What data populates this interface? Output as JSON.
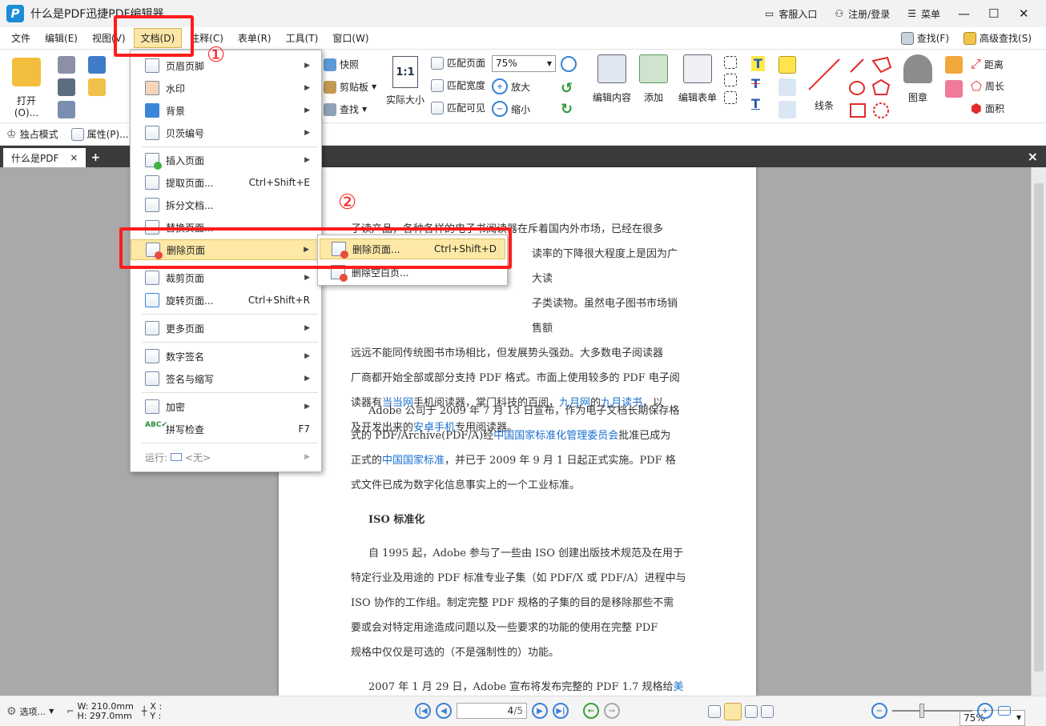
{
  "app": {
    "title": "什么是PDF迅捷PDF编辑器",
    "logo_icon": "pdf-editor-logo-icon"
  },
  "titlebar": {
    "support": "客服入口",
    "login": "注册/登录",
    "menu": "菜单"
  },
  "menubar": {
    "items": [
      "文件",
      "编辑(E)",
      "视图(V)",
      "文档(D)",
      "注释(C)",
      "表单(R)",
      "工具(T)",
      "窗口(W)"
    ],
    "find": "查找(F)",
    "advanced_find": "高级查找(S)"
  },
  "ribbon": {
    "open": "打开(O)...",
    "snapshot": "快照",
    "clipboard": "剪贴板",
    "find": "查找",
    "actual_size": "实际大小",
    "fit_page": "匹配页面",
    "fit_width": "匹配宽度",
    "fit_visible": "匹配可见",
    "zoom_value": "75%",
    "zoom_in": "放大",
    "zoom_out": "缩小",
    "edit_content": "编辑内容",
    "add": "添加",
    "edit_form": "编辑表单",
    "lines": "线条",
    "stamp": "图章",
    "distance": "距离",
    "perimeter": "周长",
    "area": "面积",
    "exclusive_mode": "独占模式",
    "properties": "属性(P)..."
  },
  "tabs": {
    "doc_tab": "什么是PDF",
    "add": "+",
    "close": "×"
  },
  "doc_menu": {
    "items": [
      {
        "label": "页眉页脚",
        "shortcut": ""
      },
      {
        "label": "水印",
        "shortcut": ""
      },
      {
        "label": "背景",
        "shortcut": ""
      },
      {
        "label": "贝茨编号",
        "shortcut": ""
      },
      {
        "label": "插入页面",
        "shortcut": ""
      },
      {
        "label": "提取页面...",
        "shortcut": "Ctrl+Shift+E"
      },
      {
        "label": "拆分文档...",
        "shortcut": ""
      },
      {
        "label": "替换页面...",
        "shortcut": ""
      },
      {
        "label": "删除页面",
        "shortcut": ""
      },
      {
        "label": "裁剪页面",
        "shortcut": ""
      },
      {
        "label": "旋转页面...",
        "shortcut": "Ctrl+Shift+R"
      },
      {
        "label": "更多页面",
        "shortcut": ""
      },
      {
        "label": "数字签名",
        "shortcut": ""
      },
      {
        "label": "签名与缩写",
        "shortcut": ""
      },
      {
        "label": "加密",
        "shortcut": ""
      },
      {
        "label": "拼写检查",
        "shortcut": "F7"
      }
    ],
    "run_label": "运行:",
    "run_value": "<无>"
  },
  "sub_menu": {
    "items": [
      {
        "label": "删除页面...",
        "shortcut": "Ctrl+Shift+D"
      },
      {
        "label": "删除空白页...",
        "shortcut": ""
      }
    ]
  },
  "annotations": {
    "step1": "①",
    "step2": "②",
    "color": "#ff1c1c"
  },
  "document": {
    "p1": [
      "子读产品，各种各样的电子书阅读器在斥着国内外市场，已经在很多",
      "读率的下降很大程度上是因为广大读",
      "子类读物。虽然电子图书市场销售额",
      "远远不能同传统图书市场相比，但发展势头强劲。大多数电子阅读器",
      "厂商都开始全部或部分支持 PDF 格式。市面上使用较多的 PDF 电子阅"
    ],
    "p1_last_a": "读器有",
    "p1_link1": "当当网",
    "p1_last_b": "手机阅读器，掌门科技的百阅，",
    "p1_link2": "九月网",
    "p1_last_c": "的",
    "p1_link3": "九月读书",
    "p1_last_d": "，以",
    "p1_end_a": "及开发出来的",
    "p1_link4": "安卓手机",
    "p1_end_b": "专用阅读器。",
    "p2_a": "Adobe 公司于 2009 年 7 月 13 日宣布，作为电子文档长期保存格",
    "p2_b": "式的 PDF/Archive(PDF/A)经",
    "p2_link1": "中国国家标准化管理委员会",
    "p2_c": "批准已成为",
    "p2_d": "正式的",
    "p2_link2": "中国国家标准",
    "p2_e": "，并已于 2009 年 9 月 1 日起正式实施。PDF 格",
    "p2_f": "式文件已成为数字化信息事实上的一个工业标准。",
    "heading": "ISO 标准化",
    "p3": [
      "自 1995 起，Adobe 参与了一些由 ISO 创建出版技术规范及在用于",
      "特定行业及用途的 PDF 标准专业子集（如 PDF/X 或 PDF/A）进程中与",
      "ISO 协作的工作组。制定完整 PDF 规格的子集的目的是移除那些不需",
      "要或会对特定用途造成问题以及一些要求的功能的使用在完整 PDF",
      "规格中仅仅是可选的（不是强制性的）功能。"
    ],
    "p4_a": "2007 年 1 月 29 日，Adobe 宣布将发布完整的 PDF 1.7 规格给",
    "p4_link": "美国"
  },
  "statusbar": {
    "options": "选项...",
    "width": "W: 210.0mm",
    "height": "H: 297.0mm",
    "x": "X :",
    "y": "Y :",
    "page": "4",
    "page_total": "/5",
    "zoom": "75%"
  }
}
